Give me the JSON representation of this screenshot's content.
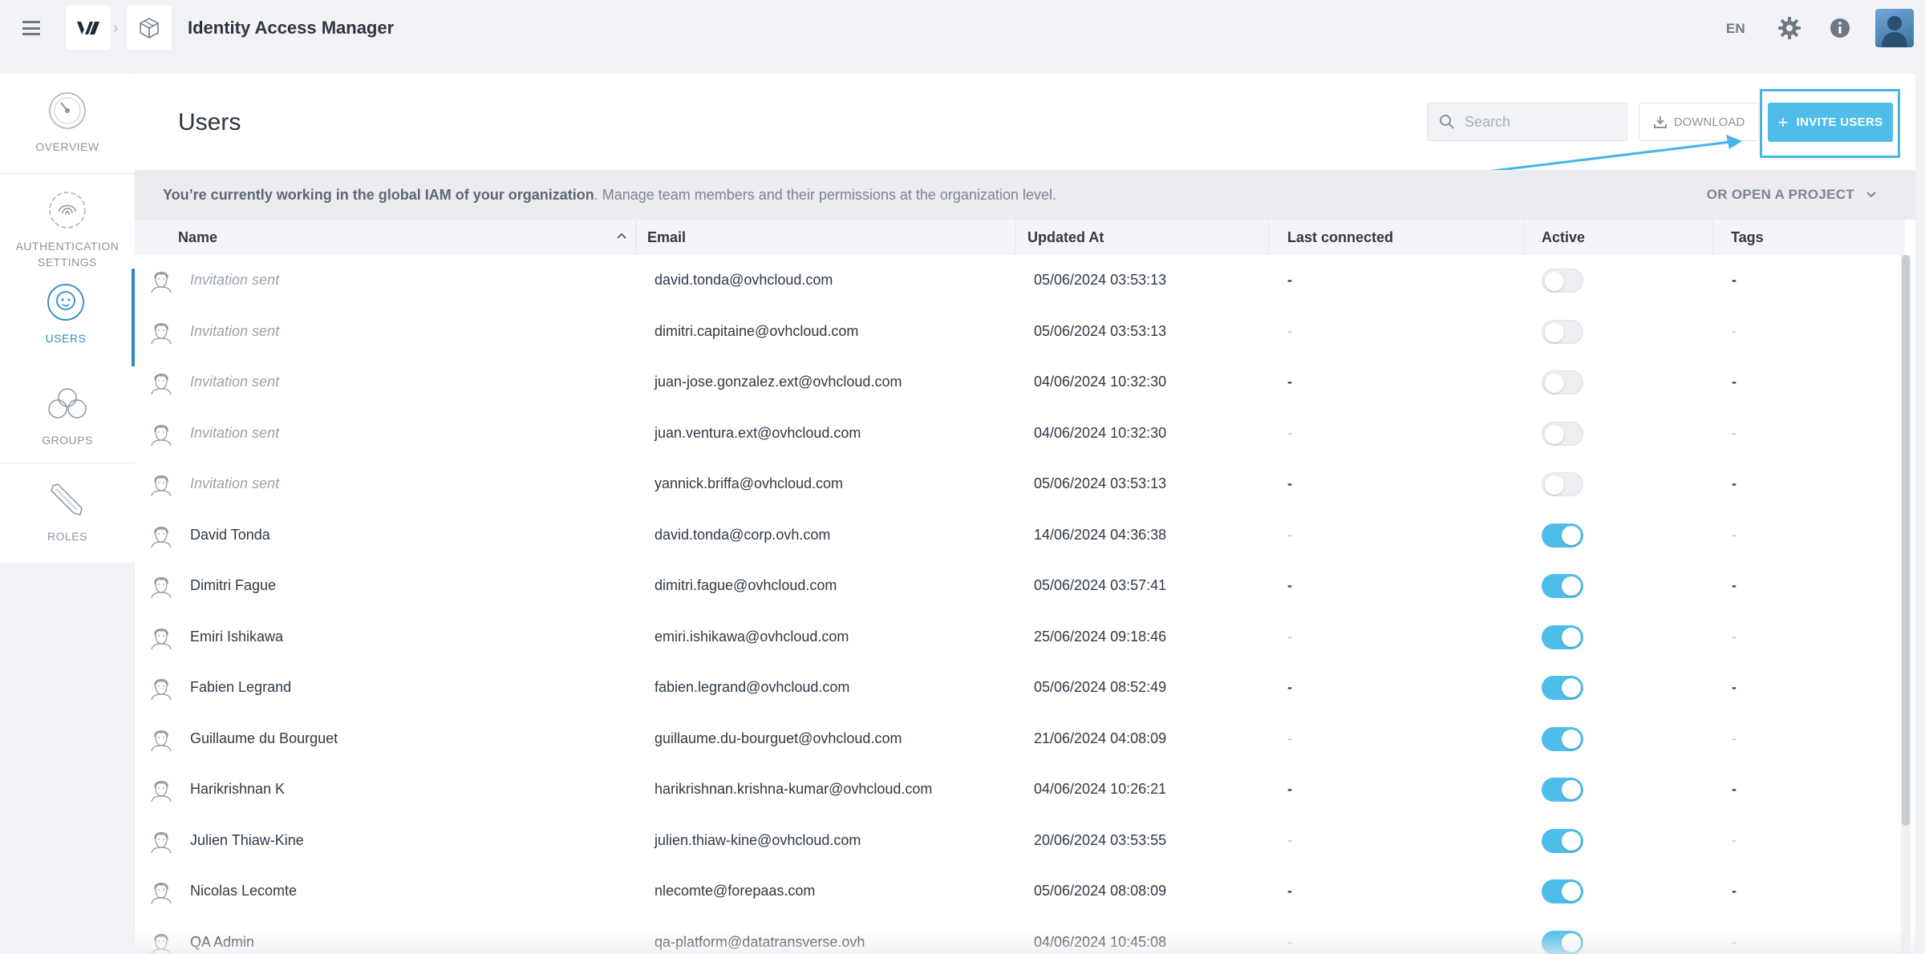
{
  "app": {
    "title": "Identity Access Manager",
    "language": "EN",
    "accent_color": "#4fbde9",
    "nav_active_color": "#2f8bc5"
  },
  "sidenav": {
    "items": [
      {
        "label": "OVERVIEW",
        "icon": "gauge-icon"
      },
      {
        "label": "AUTHENTICATION SETTINGS",
        "label_line1": "AUTHENTICATION",
        "label_line2": "SETTINGS",
        "icon": "fingerprint-gear-icon"
      },
      {
        "label": "USERS",
        "icon": "user-face-icon",
        "active": true
      },
      {
        "label": "GROUPS",
        "icon": "group-faces-icon"
      },
      {
        "label": "ROLES",
        "icon": "pencil-icon"
      }
    ]
  },
  "header": {
    "title": "Users",
    "search_placeholder": "Search",
    "download_label": "DOWNLOAD",
    "invite_label": "INVITE USERS"
  },
  "banner": {
    "bold": "You’re currently working in the global IAM of your organization",
    "rest": ". Manage team members and their permissions at the organization level.",
    "open_project_label": "OR OPEN A PROJECT"
  },
  "table": {
    "columns": [
      "Name",
      "Email",
      "Updated At",
      "Last connected",
      "Active",
      "Tags"
    ],
    "rows": [
      {
        "name": "Invitation sent",
        "invited": true,
        "email": "david.tonda@ovhcloud.com",
        "updated": "05/06/2024 03:53:13",
        "last": "-",
        "active": false,
        "tags": "-"
      },
      {
        "name": "Invitation sent",
        "invited": true,
        "email": "dimitri.capitaine@ovhcloud.com",
        "updated": "05/06/2024 03:53:13",
        "last": "-",
        "active": false,
        "tags": "-"
      },
      {
        "name": "Invitation sent",
        "invited": true,
        "email": "juan-jose.gonzalez.ext@ovhcloud.com",
        "updated": "04/06/2024 10:32:30",
        "last": "-",
        "active": false,
        "tags": "-"
      },
      {
        "name": "Invitation sent",
        "invited": true,
        "email": "juan.ventura.ext@ovhcloud.com",
        "updated": "04/06/2024 10:32:30",
        "last": "-",
        "active": false,
        "tags": "-"
      },
      {
        "name": "Invitation sent",
        "invited": true,
        "email": "yannick.briffa@ovhcloud.com",
        "updated": "05/06/2024 03:53:13",
        "last": "-",
        "active": false,
        "tags": "-"
      },
      {
        "name": "David Tonda",
        "invited": false,
        "email": "david.tonda@corp.ovh.com",
        "updated": "14/06/2024 04:36:38",
        "last": "-",
        "active": true,
        "tags": "-"
      },
      {
        "name": "Dimitri Fague",
        "invited": false,
        "email": "dimitri.fague@ovhcloud.com",
        "updated": "05/06/2024 03:57:41",
        "last": "-",
        "active": true,
        "tags": "-"
      },
      {
        "name": "Emiri Ishikawa",
        "invited": false,
        "email": "emiri.ishikawa@ovhcloud.com",
        "updated": "25/06/2024 09:18:46",
        "last": "-",
        "active": true,
        "tags": "-"
      },
      {
        "name": "Fabien Legrand",
        "invited": false,
        "email": "fabien.legrand@ovhcloud.com",
        "updated": "05/06/2024 08:52:49",
        "last": "-",
        "active": true,
        "tags": "-"
      },
      {
        "name": "Guillaume du Bourguet",
        "invited": false,
        "email": "guillaume.du-bourguet@ovhcloud.com",
        "updated": "21/06/2024 04:08:09",
        "last": "-",
        "active": true,
        "tags": "-"
      },
      {
        "name": "Harikrishnan K",
        "invited": false,
        "email": "harikrishnan.krishna-kumar@ovhcloud.com",
        "updated": "04/06/2024 10:26:21",
        "last": "-",
        "active": true,
        "tags": "-"
      },
      {
        "name": "Julien Thiaw-Kine",
        "invited": false,
        "email": "julien.thiaw-kine@ovhcloud.com",
        "updated": "20/06/2024 03:53:55",
        "last": "-",
        "active": true,
        "tags": "-"
      },
      {
        "name": "Nicolas Lecomte",
        "invited": false,
        "email": "nlecomte@forepaas.com",
        "updated": "05/06/2024 08:08:09",
        "last": "-",
        "active": true,
        "tags": "-"
      },
      {
        "name": "QA Admin",
        "invited": false,
        "email": "qa-platform@datatransverse.ovh",
        "updated": "04/06/2024 10:45:08",
        "last": "-",
        "active": true,
        "tags": "-"
      }
    ]
  }
}
